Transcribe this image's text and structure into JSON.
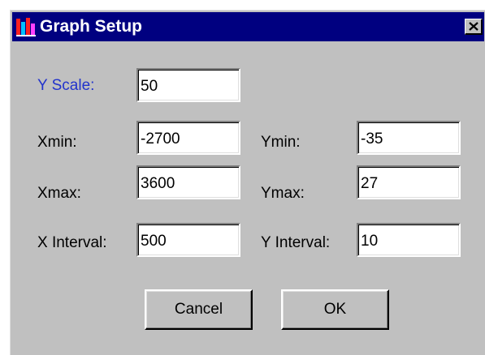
{
  "window": {
    "title": "Graph Setup",
    "title_bar_color": "#000080",
    "app_icon": "bar-chart-icon",
    "close_icon": "close-icon"
  },
  "form": {
    "y_scale": {
      "label": "Y Scale:",
      "value": "50",
      "label_color": "#2233cc"
    },
    "xmin": {
      "label": "Xmin:",
      "value": "-2700"
    },
    "ymin": {
      "label": "Ymin:",
      "value": "-35"
    },
    "xmax": {
      "label": "Xmax:",
      "value": "3600"
    },
    "ymax": {
      "label": "Ymax:",
      "value": "27"
    },
    "x_interval": {
      "label": "X Interval:",
      "value": "500"
    },
    "y_interval": {
      "label": "Y Interval:",
      "value": "10"
    }
  },
  "buttons": {
    "cancel": "Cancel",
    "ok": "OK"
  }
}
